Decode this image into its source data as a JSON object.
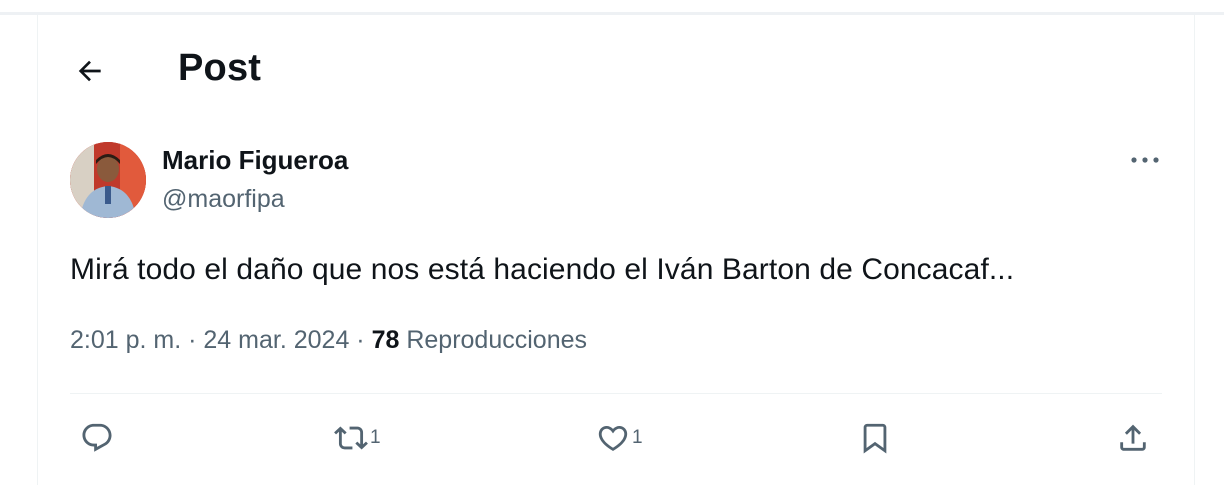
{
  "header": {
    "title": "Post",
    "back_icon": "arrow-left-icon"
  },
  "post": {
    "author": {
      "name": "Mario Figueroa",
      "handle": "@maorfipa"
    },
    "text": "Mirá todo el daño que nos está haciendo el Iván Barton de Concacaf...",
    "time": "2:01 p. m.",
    "separator": "·",
    "date": "24 mar. 2024",
    "views_count": "78",
    "views_label": "Reproducciones"
  },
  "actions": {
    "reply": {
      "icon": "reply-icon"
    },
    "repost": {
      "icon": "repost-icon",
      "count": "1"
    },
    "like": {
      "icon": "heart-icon",
      "count": "1"
    },
    "bookmark": {
      "icon": "bookmark-icon"
    },
    "share": {
      "icon": "share-icon"
    }
  },
  "colors": {
    "text": "#0f1419",
    "secondary": "#536471",
    "border": "#eff3f4"
  }
}
